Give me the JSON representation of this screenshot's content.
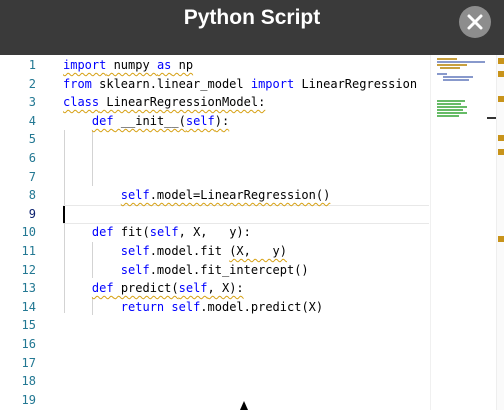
{
  "dialog": {
    "title": "Python Script",
    "close_icon": "close-icon"
  },
  "editor": {
    "line_numbers": [
      "1",
      "2",
      "3",
      "4",
      "5",
      "6",
      "7",
      "8",
      "9",
      "10",
      "11",
      "12",
      "13",
      "14",
      "15",
      "16",
      "17",
      "18",
      "19"
    ],
    "current_line": 9,
    "code_lines": [
      "import numpy as np",
      "from sklearn.linear_model import LinearRegression",
      "class LinearRegressionModel:",
      "    def __init__(self):",
      "        ",
      "        ",
      "        ",
      "        self.model=LinearRegression()",
      "",
      "    def fit(self, X,   y):",
      "        self.model.fit (X,   y)",
      "        self.model.fit_intercept()",
      "    def predict(self, X):",
      "        return self.model.predict(X)",
      "",
      "",
      "",
      "",
      ""
    ]
  },
  "colors": {
    "header_bg": "#3a3a3a",
    "keyword": "#0000ff",
    "line_number": "#237893",
    "warning_squiggle": "#d6a012"
  }
}
